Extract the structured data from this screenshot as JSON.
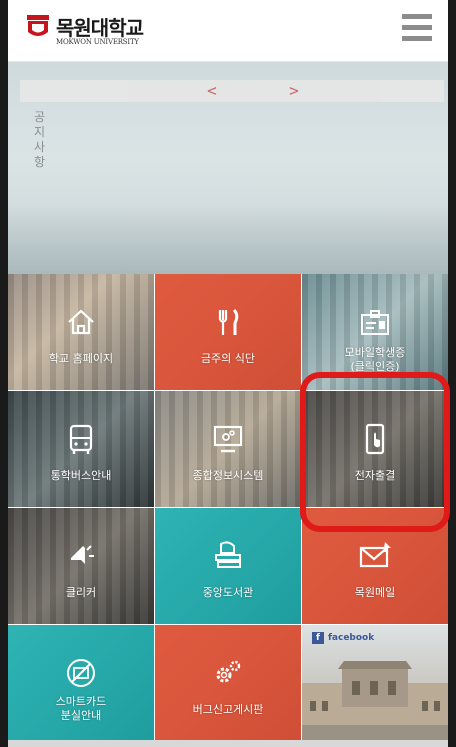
{
  "header": {
    "logo_name": "목원대학교",
    "logo_sub": "MOKWON UNIVERSITY"
  },
  "hero": {
    "prev_arrow": "<",
    "next_arrow": ">",
    "notice_title": "공지사항"
  },
  "tiles": [
    {
      "label": "학교 홈페이지",
      "icon": "home-icon"
    },
    {
      "label": "금주의 식단",
      "icon": "fork-knife-icon"
    },
    {
      "label": "모바일학생증\n(클릭인증)",
      "icon": "id-card-icon"
    },
    {
      "label": "통학버스안내",
      "icon": "bus-icon"
    },
    {
      "label": "종합정보시스템",
      "icon": "monitor-gear-icon"
    },
    {
      "label": "전자출결",
      "icon": "touch-phone-icon"
    },
    {
      "label": "클리커",
      "icon": "clicker-icon"
    },
    {
      "label": "중앙도서관",
      "icon": "books-icon"
    },
    {
      "label": "목원메일",
      "icon": "mail-icon"
    },
    {
      "label": "스마트카드\n분실안내",
      "icon": "card-lost-icon"
    },
    {
      "label": "버그신고게시판",
      "icon": "gears-icon"
    },
    {
      "label": "facebook",
      "icon": "facebook-icon"
    }
  ],
  "colors": {
    "accent_red": "#df5a3f",
    "teal": "#2fb3b3",
    "highlight": "#e01919",
    "facebook": "#3b5998"
  }
}
